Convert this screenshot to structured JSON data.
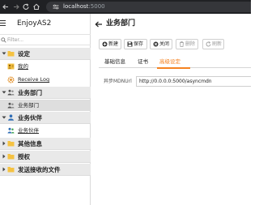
{
  "browser": {
    "url_host": "localhost",
    "url_port": ":5000"
  },
  "app": {
    "title": "EnjoyAS2"
  },
  "sidebar": {
    "filter_placeholder": "Filter...",
    "groups": [
      {
        "label": "设定",
        "items": [
          {
            "label": "我的"
          },
          {
            "label": "Receive Log"
          }
        ]
      },
      {
        "label": "业务部门",
        "items": [
          {
            "label": "业务部门",
            "selected": true
          }
        ]
      },
      {
        "label": "业务伙伴",
        "items": [
          {
            "label": "业务伙伴"
          }
        ]
      },
      {
        "label": "其他信息",
        "items": []
      },
      {
        "label": "授权",
        "items": []
      },
      {
        "label": "发送接收的文件",
        "items": []
      }
    ]
  },
  "main": {
    "title": "业务部门",
    "toolbar": {
      "new_label": "新建",
      "save_label": "保存",
      "close_label": "关闭",
      "delete_label": "删除",
      "refresh_label": "刷新"
    },
    "tabs": [
      {
        "label": "基础信息"
      },
      {
        "label": "证书"
      },
      {
        "label": "高级设定",
        "active": true
      }
    ],
    "form": {
      "async_mdn_label": "异步MDNUrl",
      "async_mdn_value": "http://0.0.0.0:5000/asyncmdn"
    }
  },
  "colors": {
    "accent": "#f58220",
    "folder": "#f5c242",
    "user_blue": "#2f6db5",
    "browser_bar": "#202124"
  }
}
